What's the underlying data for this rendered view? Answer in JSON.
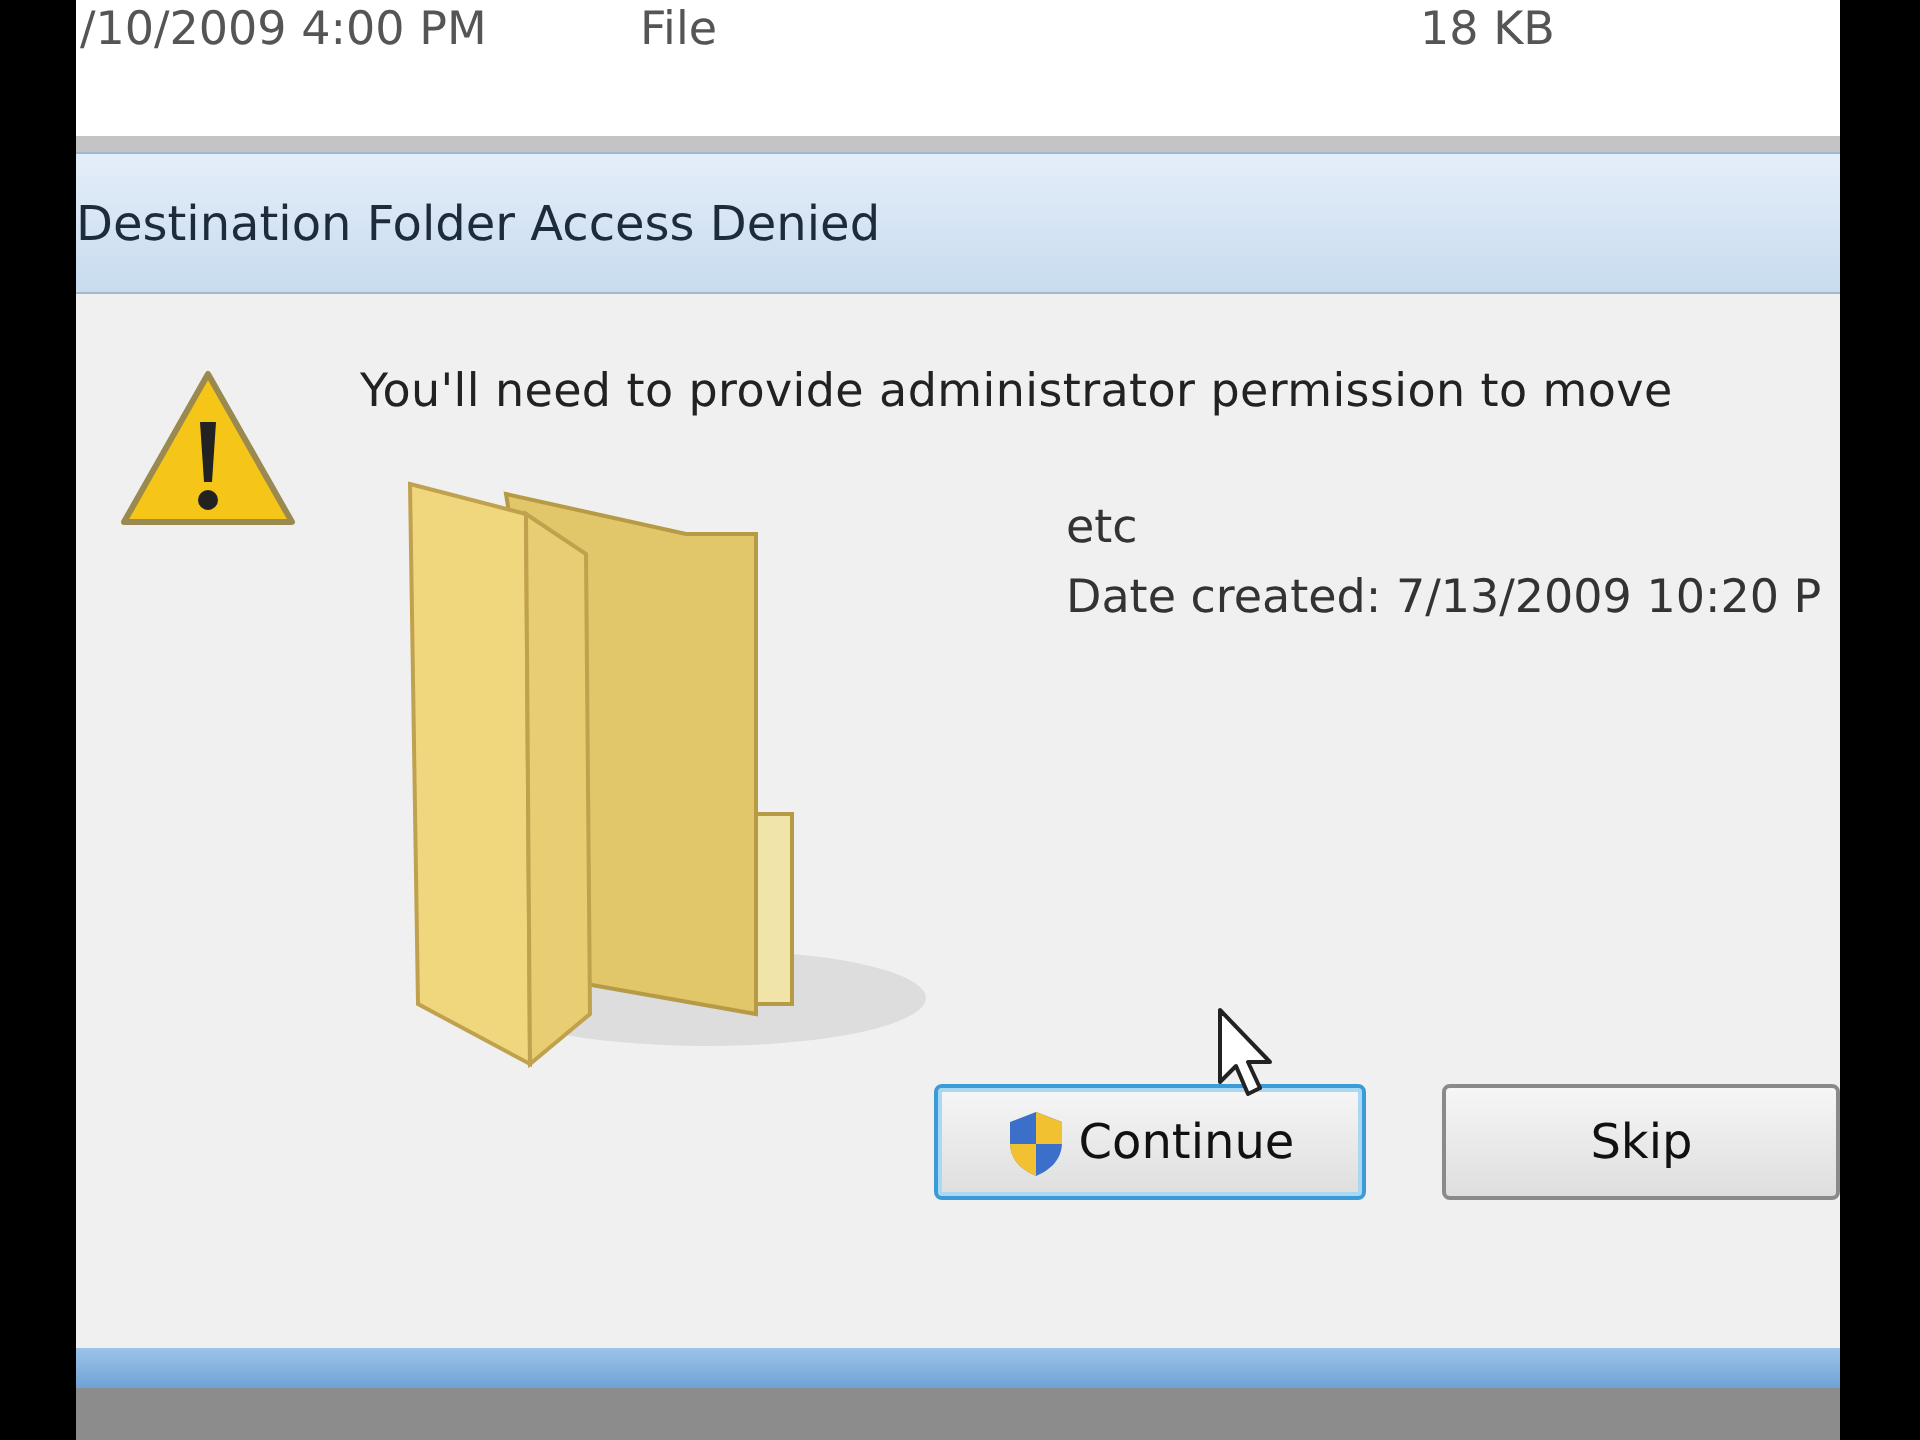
{
  "background_window": {
    "row": {
      "date_modified": "/10/2009 4:00 PM",
      "type": "File",
      "size": "18 KB"
    }
  },
  "dialog": {
    "title": "Destination Folder Access Denied",
    "message": "You'll need to provide administrator permission to move",
    "item": {
      "name": "etc",
      "date_created": "Date created: 7/13/2009 10:20 P"
    },
    "buttons": [
      {
        "label": "Continue",
        "kind": "shield",
        "focused": true
      },
      {
        "label": "Skip",
        "kind": "plain",
        "focused": false
      }
    ]
  }
}
